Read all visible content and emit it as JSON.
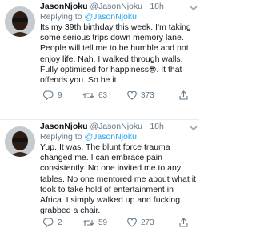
{
  "tweets": [
    {
      "name": "JasonNjoku",
      "handle": "@JasonNjoku",
      "sep": "·",
      "time": "18h",
      "replying_prefix": "Replying to ",
      "replying_to": "@JasonNjoku",
      "lines": [
        "Its my 39th birthday this week. I'm taking",
        "some serious trips down memory lane.",
        "People will tell me to be humble and not",
        "enjoy life. Nah. I walked through walls.",
        "Fully optimised for happiness",
        "offends you. So be it."
      ],
      "line5_after_emoji": ". It that",
      "emoji": "😎",
      "replies": "9",
      "retweets": "63",
      "likes": "373"
    },
    {
      "name": "JasonNjoku",
      "handle": "@JasonNjoku",
      "sep": "·",
      "time": "18h",
      "replying_prefix": "Replying to ",
      "replying_to": "@JasonNjoku",
      "lines": [
        "Yup. It was. The blunt force trauma",
        "changed me. I can embrace pain",
        "consistently. No one invited me to any",
        "tables. No one mentored me about what it",
        "took to take hold of entertainment in",
        "Africa. I simply walked up and fucking",
        "grabbed a chair."
      ],
      "replies": "2",
      "retweets": "59",
      "likes": "273"
    }
  ],
  "icons": {
    "avatar": "avatar-man-with-sunglasses",
    "reply": "reply-icon",
    "retweet": "retweet-icon",
    "like": "heart-icon",
    "share": "share-icon",
    "caret": "chevron-down-icon"
  },
  "colors": {
    "link": "#1da1f2",
    "muted": "#657786",
    "text": "#14171a",
    "divider": "#e6ecf0"
  }
}
